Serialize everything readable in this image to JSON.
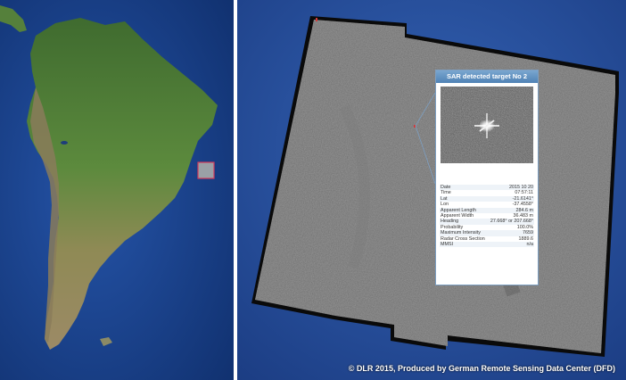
{
  "popup": {
    "title": "SAR detected target No 2",
    "rows": [
      {
        "label": "Date",
        "value": "2015 10 20"
      },
      {
        "label": "Time",
        "value": "07:57:11"
      },
      {
        "label": "Lat",
        "value": "-21.6141°"
      },
      {
        "label": "Lon",
        "value": "-37.4558°"
      },
      {
        "label": "Apparent Length",
        "value": "284.6 m"
      },
      {
        "label": "Apparent Width",
        "value": "36.483 m"
      },
      {
        "label": "Heading",
        "value": "27.668° or 207.668°"
      },
      {
        "label": "Probability",
        "value": "100.0%"
      },
      {
        "label": "Maximum Intensity",
        "value": "7659"
      },
      {
        "label": "Radar Cross Section",
        "value": "1889.6"
      },
      {
        "label": "MMSI",
        "value": "n/a"
      }
    ]
  },
  "copyright": "© DLR 2015, Produced by German Remote Sensing Data Center (DFD)",
  "colors": {
    "ocean": "#1a3f8a",
    "land": "#4f7d3a",
    "highlight": "#d23a5a",
    "sar_gray": "#6b6b6b",
    "popup_header": "#5b8cbf"
  }
}
